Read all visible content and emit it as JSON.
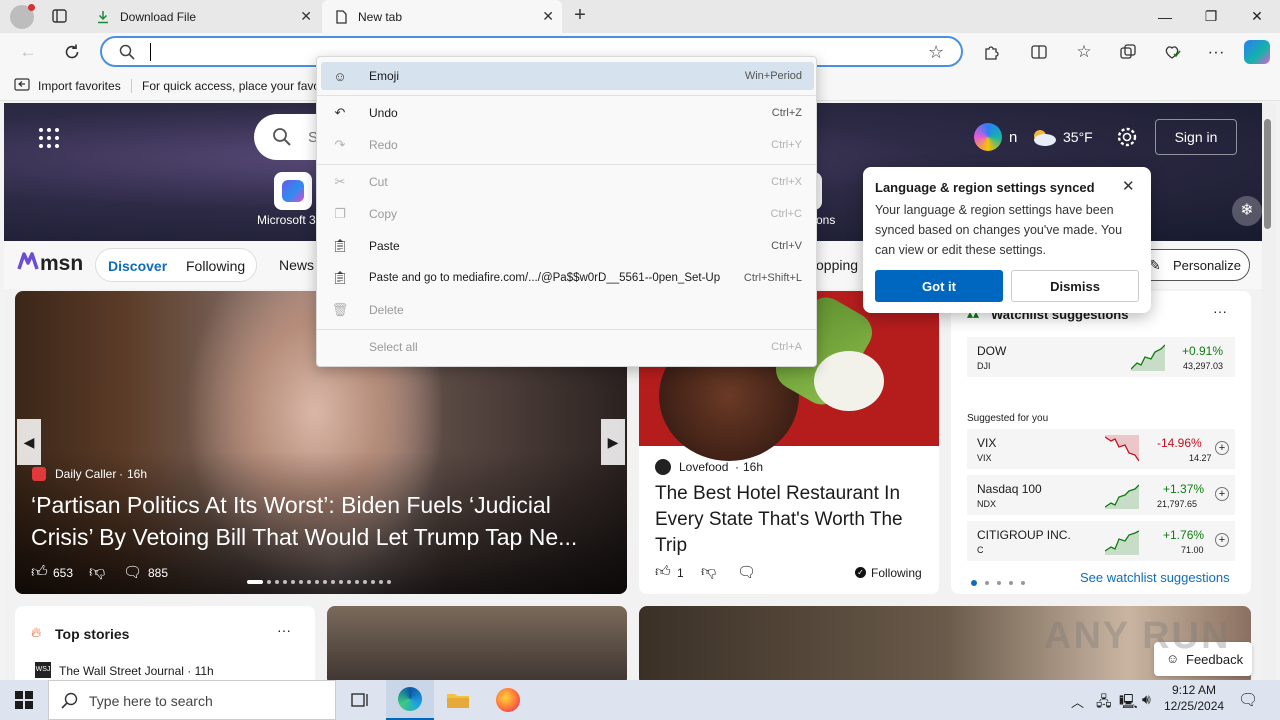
{
  "tabs": [
    {
      "title": "Download File",
      "icon": "download-icon"
    },
    {
      "title": "New tab",
      "icon": "page-icon"
    }
  ],
  "window": {
    "minimize": "—",
    "maximize": "❐",
    "close": "✕"
  },
  "address": {
    "value": "",
    "placeholder": ""
  },
  "favorites": {
    "import_label": "Import favorites",
    "hint": "For quick access, place your favo"
  },
  "context_menu": {
    "items": [
      {
        "label": "Emoji",
        "shortcut": "Win+Period",
        "icon": "emoji-icon",
        "enabled": true,
        "highlighted": true
      },
      {
        "label": "Undo",
        "shortcut": "Ctrl+Z",
        "icon": "undo-icon",
        "enabled": true
      },
      {
        "label": "Redo",
        "shortcut": "Ctrl+Y",
        "icon": "redo-icon",
        "enabled": false
      },
      {
        "label": "Cut",
        "shortcut": "Ctrl+X",
        "icon": "cut-icon",
        "enabled": false
      },
      {
        "label": "Copy",
        "shortcut": "Ctrl+C",
        "icon": "copy-icon",
        "enabled": false
      },
      {
        "label": "Paste",
        "shortcut": "Ctrl+V",
        "icon": "paste-icon",
        "enabled": true
      },
      {
        "label": "Paste and go to mediafire.com/.../@Pa$$w0rD__5561--0pen_Set-Up",
        "shortcut": "Ctrl+Shift+L",
        "icon": "paste-go-icon",
        "enabled": true
      },
      {
        "label": "Delete",
        "shortcut": "",
        "icon": "delete-icon",
        "enabled": false
      },
      {
        "label": "Select all",
        "shortcut": "Ctrl+A",
        "icon": "",
        "enabled": false
      }
    ]
  },
  "msn": {
    "search_placeholder": "S",
    "shortcut_label": "Microsoft 3",
    "shortcut_label_right": "ons",
    "weather": "35°F",
    "weather_prefix": "n",
    "sign_in": "Sign in",
    "logo": "msn",
    "nav": [
      "Discover",
      "Following",
      "News"
    ],
    "nav_right": "opping",
    "personalize": "Personalize"
  },
  "popup": {
    "title": "Language & region settings synced",
    "body": "Your language & region settings have been synced based on changes you've made. You can view or edit these settings.",
    "got_it": "Got it",
    "dismiss": "Dismiss"
  },
  "main_story": {
    "source": "Daily Caller",
    "age": "16h",
    "headline": "‘Partisan Politics At Its Worst’: Biden Fuels ‘Judicial Crisis’ By Vetoing Bill That Would Let Trump Tap Ne...",
    "likes": "653",
    "comments": "885"
  },
  "food_story": {
    "source": "Lovefood",
    "age": "16h",
    "headline": "The Best Hotel Restaurant In Every State That's Worth The Trip",
    "likes": "1",
    "following": "Following"
  },
  "watchlist": {
    "title": "Watchlist suggestions",
    "suggested_label": "Suggested for you",
    "see_all": "See watchlist suggestions",
    "items": [
      {
        "name": "DOW",
        "ticker": "DJI",
        "change": "+0.91%",
        "price": "43,297.03",
        "up": true
      },
      {
        "name": "VIX",
        "ticker": "VIX",
        "change": "-14.96%",
        "price": "14.27",
        "up": false
      },
      {
        "name": "Nasdaq 100",
        "ticker": "NDX",
        "change": "+1.37%",
        "price": "21,797.65",
        "up": true
      },
      {
        "name": "CITIGROUP INC.",
        "ticker": "C",
        "change": "+1.76%",
        "price": "71.00",
        "up": true
      }
    ]
  },
  "top_stories": {
    "title": "Top stories",
    "first_source": "The Wall Street Journal · 11h"
  },
  "feedback": "Feedback",
  "watermark": "ANY RUN",
  "taskbar": {
    "search_placeholder": "Type here to search",
    "time": "9:12 AM",
    "date": "12/25/2024"
  },
  "colors": {
    "accent": "#0f6cbd",
    "up": "#107c10",
    "down": "#c50f1f",
    "got_it": "#0067c0"
  }
}
